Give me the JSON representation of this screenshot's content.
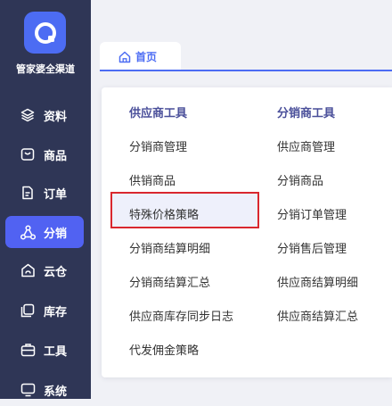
{
  "sidebar": {
    "brand": "管家婆全渠道",
    "items": [
      {
        "label": "资料",
        "icon": "layers-icon"
      },
      {
        "label": "商品",
        "icon": "box-icon"
      },
      {
        "label": "订单",
        "icon": "document-icon"
      },
      {
        "label": "分销",
        "icon": "network-icon",
        "active": true
      },
      {
        "label": "云仓",
        "icon": "cloud-warehouse-icon"
      },
      {
        "label": "库存",
        "icon": "inventory-icon"
      },
      {
        "label": "工具",
        "icon": "toolbox-icon"
      },
      {
        "label": "系统",
        "icon": "monitor-icon"
      }
    ]
  },
  "tabs": [
    {
      "label": "首页",
      "icon": "home-icon",
      "active": true
    }
  ],
  "menu": {
    "columns": [
      {
        "title": "供应商工具",
        "items": [
          "分销商管理",
          "供销商品",
          "特殊价格策略",
          "分销商结算明细",
          "分销商结算汇总",
          "供应商库存同步日志",
          "代发佣金策略"
        ]
      },
      {
        "title": "分销商工具",
        "items": [
          "供应商管理",
          "分销商品",
          "分销订单管理",
          "分销售后管理",
          "供应商结算明细",
          "供应商结算汇总"
        ]
      }
    ],
    "highlighted": "特殊价格策略"
  },
  "colors": {
    "sidebar_bg": "#2f3656",
    "accent": "#4c6cf3",
    "active_nav": "#5162f2",
    "highlight_border": "#d9272e",
    "column_title": "#4a4f9a"
  }
}
